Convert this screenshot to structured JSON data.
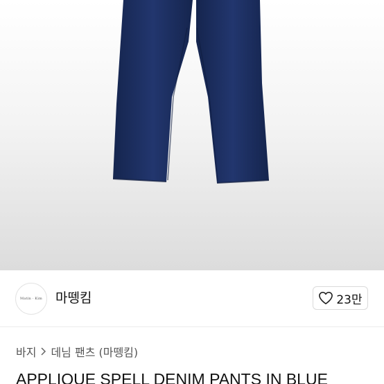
{
  "product": {
    "image_alt": "denim pants",
    "title": "APPLIQUE SPELL DENIM PANTS IN BLUE"
  },
  "seller": {
    "logo_text": "Matin · Kim",
    "name": "마뗑킴"
  },
  "like": {
    "icon": "heart-outline-icon",
    "count": "23만"
  },
  "breadcrumb": {
    "items": [
      "바지",
      "데님 팬츠 (마뗑킴)"
    ],
    "separator_icon": "chevron-right-icon"
  },
  "colors": {
    "denim": "#1c2f63",
    "denim_dark": "#142450",
    "background_top": "#ffffff",
    "background_bottom": "#dcdcdc"
  }
}
